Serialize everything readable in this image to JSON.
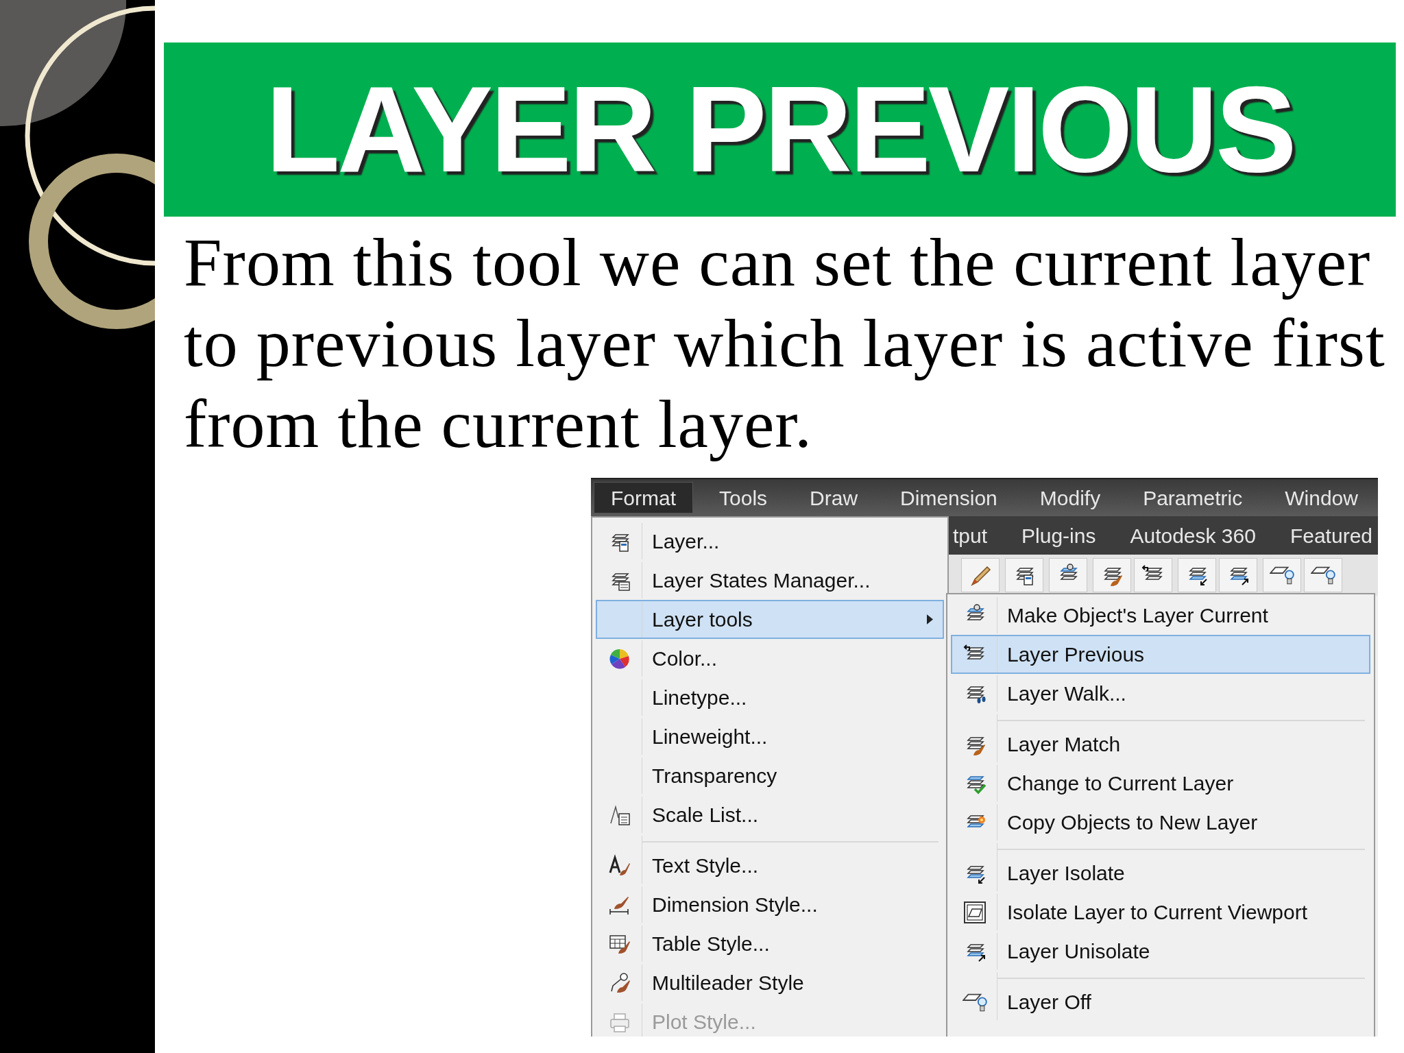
{
  "slide": {
    "title": "LAYER PREVIOUS",
    "body_lines": [
      "From this tool we can set the current layer",
      "to previous layer which layer is active first",
      "from the current layer."
    ]
  },
  "screenshot": {
    "menu_bar": [
      {
        "label": "Format",
        "selected": true
      },
      {
        "label": "Tools",
        "selected": false
      },
      {
        "label": "Draw",
        "selected": false
      },
      {
        "label": "Dimension",
        "selected": false
      },
      {
        "label": "Modify",
        "selected": false
      },
      {
        "label": "Parametric",
        "selected": false
      },
      {
        "label": "Window",
        "selected": false
      }
    ],
    "ribbon_tabs": [
      "tput",
      "Plug-ins",
      "Autodesk 360",
      "Featured"
    ],
    "format_menu": [
      {
        "label": "Layer...",
        "selected": false,
        "disabled": false,
        "submenu": false,
        "separator_before": false
      },
      {
        "label": "Layer States Manager...",
        "selected": false,
        "disabled": false,
        "submenu": false,
        "separator_before": false
      },
      {
        "label": "Layer tools",
        "selected": true,
        "disabled": false,
        "submenu": true,
        "separator_before": false
      },
      {
        "label": "Color...",
        "selected": false,
        "disabled": false,
        "submenu": false,
        "separator_before": false
      },
      {
        "label": "Linetype...",
        "selected": false,
        "disabled": false,
        "submenu": false,
        "separator_before": false
      },
      {
        "label": "Lineweight...",
        "selected": false,
        "disabled": false,
        "submenu": false,
        "separator_before": false
      },
      {
        "label": "Transparency",
        "selected": false,
        "disabled": false,
        "submenu": false,
        "separator_before": false
      },
      {
        "label": "Scale List...",
        "selected": false,
        "disabled": false,
        "submenu": false,
        "separator_before": false
      },
      {
        "label": "Text Style...",
        "selected": false,
        "disabled": false,
        "submenu": false,
        "separator_before": true
      },
      {
        "label": "Dimension Style...",
        "selected": false,
        "disabled": false,
        "submenu": false,
        "separator_before": false
      },
      {
        "label": "Table Style...",
        "selected": false,
        "disabled": false,
        "submenu": false,
        "separator_before": false
      },
      {
        "label": "Multileader Style",
        "selected": false,
        "disabled": false,
        "submenu": false,
        "separator_before": false
      },
      {
        "label": "Plot Style...",
        "selected": false,
        "disabled": true,
        "submenu": false,
        "separator_before": false
      }
    ],
    "layer_tools_menu": [
      {
        "label": "Make Object's Layer Current",
        "selected": false,
        "separator_before": false
      },
      {
        "label": "Layer Previous",
        "selected": true,
        "separator_before": false
      },
      {
        "label": "Layer Walk...",
        "selected": false,
        "separator_before": false
      },
      {
        "label": "Layer Match",
        "selected": false,
        "separator_before": true
      },
      {
        "label": "Change to Current Layer",
        "selected": false,
        "separator_before": false
      },
      {
        "label": "Copy Objects to New Layer",
        "selected": false,
        "separator_before": false
      },
      {
        "label": "Layer Isolate",
        "selected": false,
        "separator_before": true
      },
      {
        "label": "Isolate Layer to Current Viewport",
        "selected": false,
        "separator_before": false
      },
      {
        "label": "Layer Unisolate",
        "selected": false,
        "separator_before": false
      },
      {
        "label": "Layer Off",
        "selected": false,
        "separator_before": true
      }
    ]
  }
}
